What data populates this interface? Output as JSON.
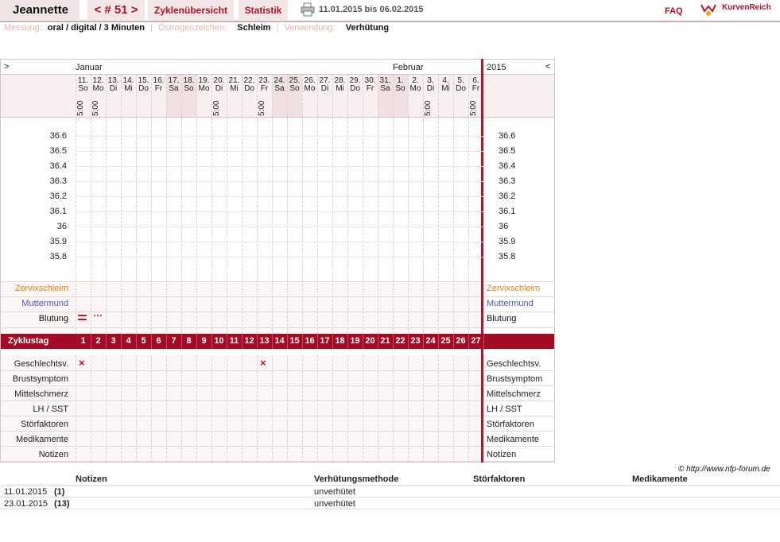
{
  "header": {
    "user": "Jeannette",
    "cycle_nav": "< # 51 >",
    "tab_overview": "Zyklenübersicht",
    "tab_stats": "Statistik",
    "date_range": "11.01.2015 bis 06.02.2015",
    "faq": "FAQ",
    "brand": "KurvenReich"
  },
  "meta": {
    "measure_label": "Messung:",
    "measure_value": "oral / digital / 3 Minuten",
    "sep": "|",
    "estrogen_label": "Östrogenzeichen:",
    "estrogen_value": "Schleim",
    "usage_label": "Verwendung:",
    "usage_value": "Verhütung"
  },
  "chart": {
    "expand_left": ">",
    "collapse_right": "<",
    "year": "2015",
    "month_1": "Januar",
    "month_2": "Februar",
    "days": [
      {
        "d": "11.",
        "w": "So",
        "t": "5:00",
        "we": false
      },
      {
        "d": "12.",
        "w": "Mo",
        "t": "5:00",
        "we": false
      },
      {
        "d": "13.",
        "w": "Di",
        "t": "",
        "we": false
      },
      {
        "d": "14.",
        "w": "Mi",
        "t": "",
        "we": false
      },
      {
        "d": "15.",
        "w": "Do",
        "t": "",
        "we": false
      },
      {
        "d": "16.",
        "w": "Fr",
        "t": "",
        "we": false
      },
      {
        "d": "17.",
        "w": "Sa",
        "t": "",
        "we": true
      },
      {
        "d": "18.",
        "w": "So",
        "t": "",
        "we": true
      },
      {
        "d": "19.",
        "w": "Mo",
        "t": "",
        "we": false
      },
      {
        "d": "20.",
        "w": "Di",
        "t": "5:00",
        "we": false
      },
      {
        "d": "21.",
        "w": "Mi",
        "t": "",
        "we": false
      },
      {
        "d": "22.",
        "w": "Do",
        "t": "",
        "we": false
      },
      {
        "d": "23.",
        "w": "Fr",
        "t": "5:00",
        "we": false
      },
      {
        "d": "24.",
        "w": "Sa",
        "t": "",
        "we": true
      },
      {
        "d": "25.",
        "w": "So",
        "t": "",
        "we": true
      },
      {
        "d": "26.",
        "w": "Mo",
        "t": "",
        "we": false
      },
      {
        "d": "27.",
        "w": "Di",
        "t": "",
        "we": false
      },
      {
        "d": "28.",
        "w": "Mi",
        "t": "",
        "we": false
      },
      {
        "d": "29.",
        "w": "Do",
        "t": "",
        "we": false
      },
      {
        "d": "30.",
        "w": "Fr",
        "t": "",
        "we": false
      },
      {
        "d": "31.",
        "w": "Sa",
        "t": "",
        "we": true
      },
      {
        "d": "1.",
        "w": "So",
        "t": "",
        "we": true
      },
      {
        "d": "2.",
        "w": "Mo",
        "t": "",
        "we": false
      },
      {
        "d": "3.",
        "w": "Di",
        "t": "5:00",
        "we": false
      },
      {
        "d": "4.",
        "w": "Mi",
        "t": "",
        "we": false
      },
      {
        "d": "5.",
        "w": "Do",
        "t": "",
        "we": false
      },
      {
        "d": "6.",
        "w": "Fr",
        "t": "5:00",
        "we": false
      }
    ],
    "temps": [
      "36.6",
      "36.5",
      "36.4",
      "36.3",
      "36.2",
      "36.1",
      "36",
      "35.9",
      "35.8"
    ],
    "row_cervix": "Zervixschleim",
    "row_os": "Muttermund",
    "row_bleeding": "Blutung",
    "cycle_day_label": "Zyklustag",
    "cycle_days": [
      "1",
      "2",
      "3",
      "4",
      "5",
      "6",
      "7",
      "8",
      "9",
      "10",
      "11",
      "12",
      "13",
      "14",
      "15",
      "16",
      "17",
      "18",
      "19",
      "20",
      "21",
      "22",
      "23",
      "24",
      "25",
      "26",
      "27"
    ],
    "bleeding_marks": [
      {
        "day": 1,
        "symbol": "strong"
      },
      {
        "day": 2,
        "symbol": "spotting"
      }
    ],
    "intercourse_days": [
      1,
      13
    ],
    "lower_rows": [
      "Geschlechtsv.",
      "Brustsymptom",
      "Mittelschmerz",
      "LH / SST",
      "Störfaktoren",
      "Medikamente",
      "Notizen"
    ],
    "colors": {
      "cervix": "#e8831a",
      "os": "#4855c4",
      "accent": "#a30a24",
      "weekend": "#f0e0e0"
    }
  },
  "copyright": "© http://www.nfp-forum.de",
  "notes": {
    "headers": [
      "Notizen",
      "Verhütungsmethode",
      "Störfaktoren",
      "Medikamente"
    ],
    "rows": [
      {
        "date": "11.01.2015",
        "day": "(1)",
        "method": "unverhütet"
      },
      {
        "date": "23.01.2015",
        "day": "(13)",
        "method": "unverhütet"
      }
    ]
  }
}
